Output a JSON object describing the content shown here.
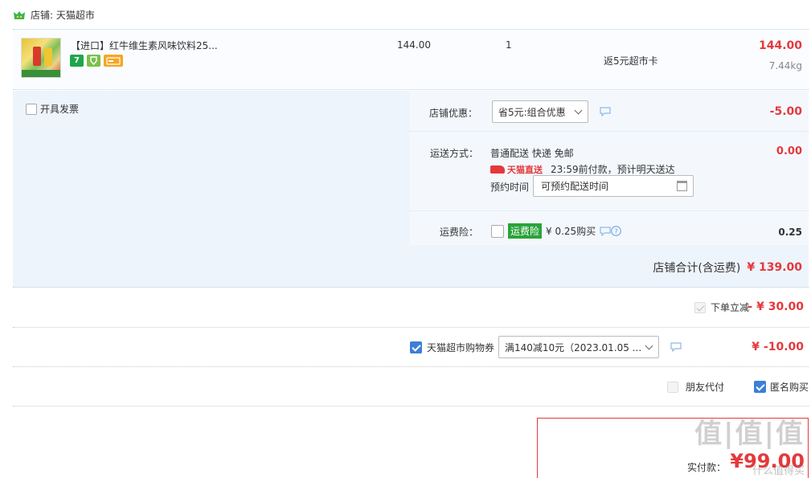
{
  "store": {
    "label": "店铺: 天猫超市",
    "icon": "store-icon"
  },
  "item": {
    "title": "【进口】红牛维生素风味饮料25...",
    "badges": [
      "7"
    ],
    "unit_price": "144.00",
    "quantity": "1",
    "rebate": "返5元超市卡",
    "total": "144.00",
    "weight": "7.44kg"
  },
  "invoice": {
    "label": "开具发票"
  },
  "shop_discount": {
    "label": "店铺优惠：",
    "selected": "省5元:组合优惠",
    "amount": "-5.00"
  },
  "shipping": {
    "label": "运送方式：",
    "method": "普通配送 快递 免邮",
    "direct_label": "天猫直送",
    "direct_info": "23:59前付款，预计明天送达",
    "reserve_label": "预约时间",
    "reserve_value": "可预约配送时间",
    "amount": "0.00"
  },
  "insurance": {
    "label": "运费险：",
    "tag": "运费险",
    "price": "¥ 0.25购买",
    "amount": "0.25"
  },
  "subtotal": {
    "label": "店铺合计(含运费)",
    "amount": "¥ 139.00"
  },
  "instant_discount": {
    "label": "下单立减",
    "amount": "- ¥ 30.00"
  },
  "coupon": {
    "label": "天猫超市购物券",
    "selected": "满140减10元（2023.01.05 ...",
    "amount": "¥ -10.00"
  },
  "options": {
    "friend_pay": "朋友代付",
    "anonymous": "匿名购买"
  },
  "payment": {
    "label": "实付款：",
    "amount": "¥99.00",
    "watermark": "值|值|值",
    "watermark_site": "什么值得买"
  },
  "colors": {
    "price_red": "#e4393c",
    "option_bg": "#edf4fc",
    "check_blue": "#3d7fd6",
    "green_tag": "#2aa33a"
  }
}
